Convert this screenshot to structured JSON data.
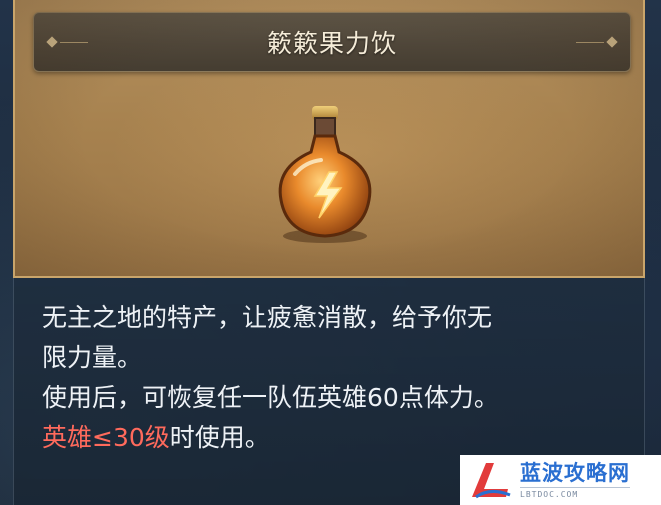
{
  "item": {
    "name": "簌簌果力饮",
    "icon": "stamina-potion-icon",
    "description_lines": [
      "无主之地的特产，让疲惫消散，给予你无",
      "限力量。",
      "使用后，可恢复任一队伍英雄60点体力。"
    ],
    "requirement": "英雄≤30级",
    "requirement_suffix": "时使用。"
  },
  "watermark": {
    "title": "蓝波攻略网",
    "subtitle": "LBTDOC.COM"
  },
  "colors": {
    "panel_border": "#c9a56b",
    "requirement_red": "#ff6a5c",
    "text": "#eef2f6"
  }
}
